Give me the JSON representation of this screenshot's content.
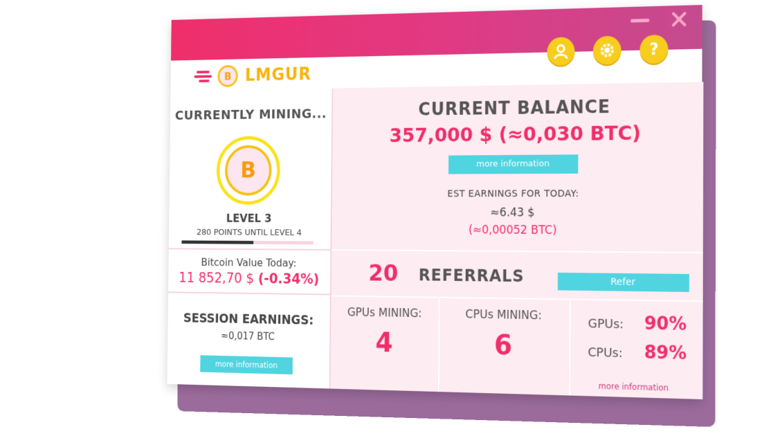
{
  "app": {
    "name": "LMGUR",
    "logo_symbol": "B"
  },
  "colors": {
    "primary": "#f02e6b",
    "accent": "#50d4e0",
    "gold": "#f9cd1e",
    "panel": "#fdecf2",
    "shadow": "#9b6b9c"
  },
  "header_icons": [
    "user-icon",
    "gear-icon",
    "help-icon"
  ],
  "mining": {
    "title": "CURRENTLY MINING...",
    "coin_symbol": "B",
    "level": "LEVEL 3",
    "points_until": "280 POINTS UNTIL LEVEL 4",
    "progress": 0.55
  },
  "bitcoin": {
    "label": "Bitcoin Value Today:",
    "value": "11 852,70 $",
    "change": "(-0.34%)"
  },
  "session": {
    "title": "SESSION EARNINGS:",
    "value": "≈0,017 BTC",
    "more_label": "more information"
  },
  "balance": {
    "title": "CURRENT BALANCE",
    "value": "357,000 $ (≈0,030 BTC)",
    "more_label": "more information",
    "est_label": "EST EARNINGS FOR TODAY:",
    "est_usd": "≈6.43 $",
    "est_btc": "(≈0,00052 BTC)"
  },
  "referrals": {
    "count": "20",
    "label": "REFERRALS",
    "button": "Refer"
  },
  "stats": {
    "gpus_label": "GPUs MINING:",
    "gpus_value": "4",
    "cpus_label": "CPUs MINING:",
    "cpus_value": "6",
    "gpu_usage_label": "GPUs:",
    "gpu_usage_value": "90%",
    "cpu_usage_label": "CPUs:",
    "cpu_usage_value": "89%",
    "more_label": "more information"
  }
}
